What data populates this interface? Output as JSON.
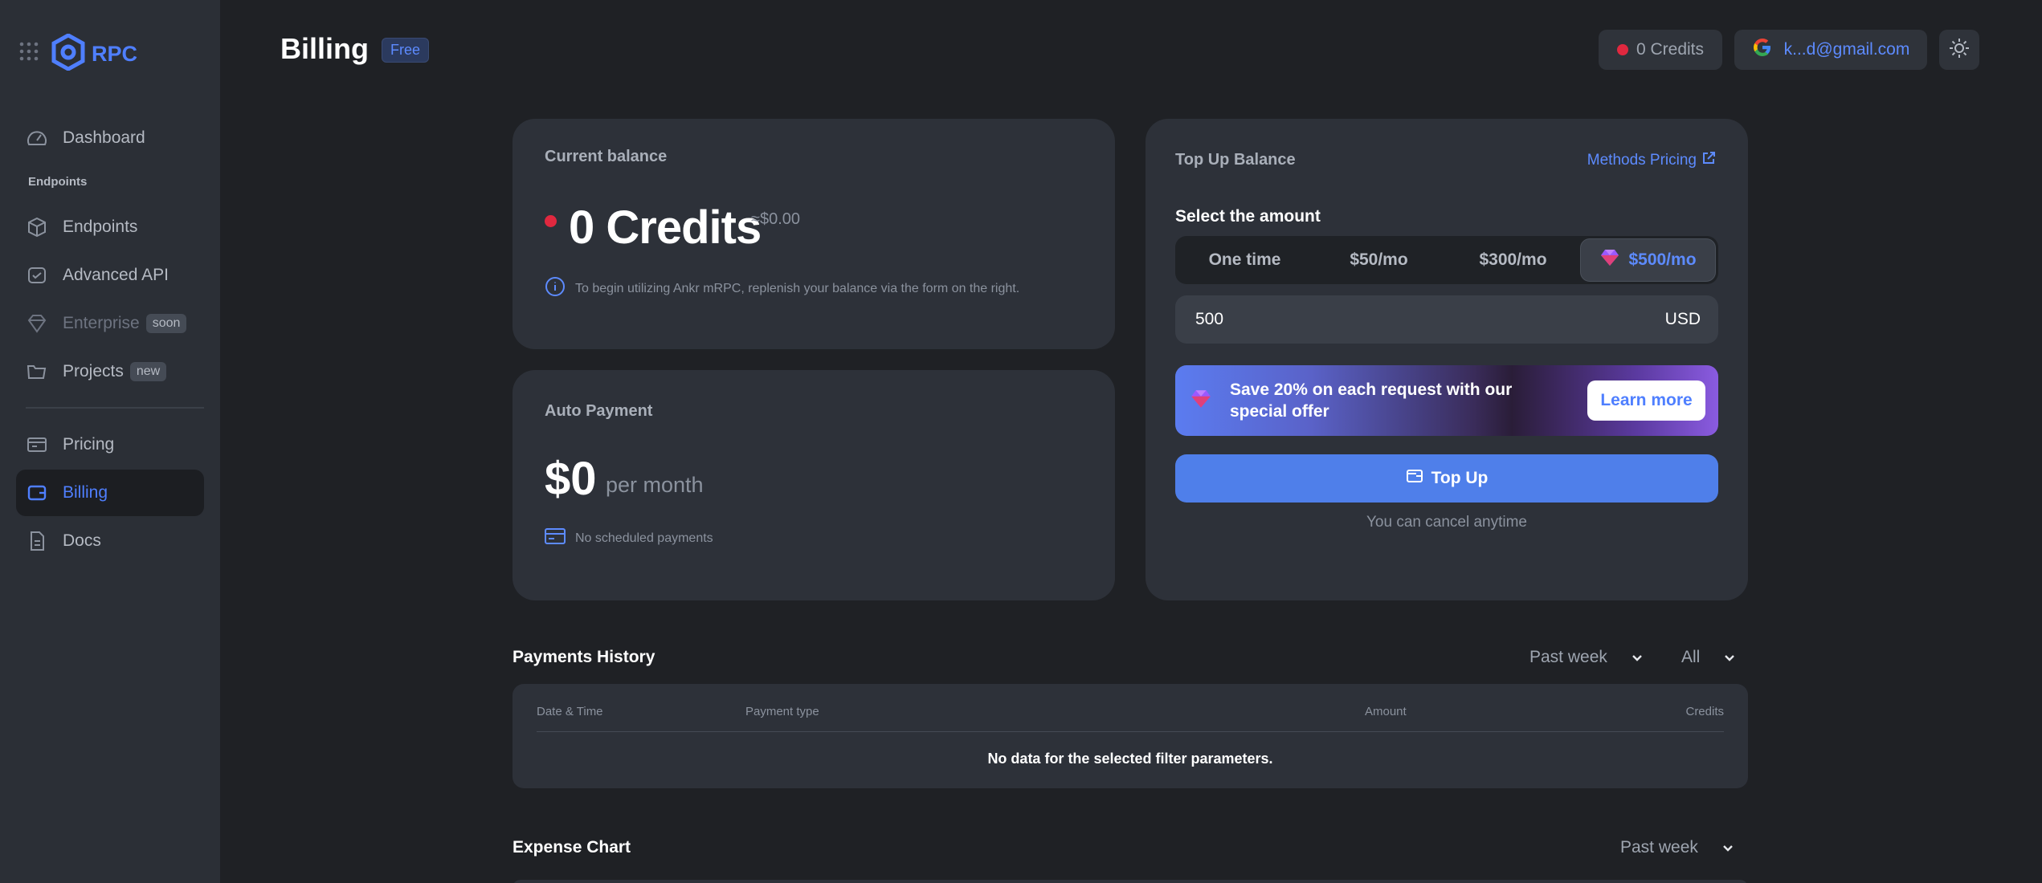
{
  "sidebar": {
    "logo_text": "RPC",
    "section_label": "Endpoints",
    "items": [
      {
        "label": "Dashboard",
        "icon": "gauge-icon"
      },
      {
        "label": "Endpoints",
        "icon": "cube-icon"
      },
      {
        "label": "Advanced API",
        "icon": "advanced-api-icon"
      },
      {
        "label": "Enterprise",
        "icon": "diamond-icon",
        "badge": "soon"
      },
      {
        "label": "Projects",
        "icon": "folder-icon",
        "badge": "new"
      },
      {
        "label": "Pricing",
        "icon": "pricing-icon"
      },
      {
        "label": "Billing",
        "icon": "wallet-icon"
      },
      {
        "label": "Docs",
        "icon": "document-icon"
      }
    ]
  },
  "header": {
    "title": "Billing",
    "plan_badge": "Free",
    "credits": "0 Credits",
    "user_email": "k...d@gmail.com"
  },
  "balance": {
    "title": "Current balance",
    "credits": "0 Credits",
    "usd_equiv": "≈$0.00",
    "info": "To begin utilizing Ankr mRPC, replenish your balance via the form on the right."
  },
  "auto_payment": {
    "title": "Auto Payment",
    "amount": "$0",
    "period": "per month",
    "schedule": "No scheduled payments"
  },
  "topup": {
    "title": "Top Up Balance",
    "methods_link": "Methods Pricing",
    "select_label": "Select the amount",
    "options": [
      "One time",
      "$50/mo",
      "$300/mo",
      "$500/mo"
    ],
    "selected_option": "$500/mo",
    "amount_value": "500",
    "currency": "USD",
    "promo_text": "Save 20% on each request with our special offer",
    "promo_button": "Learn more",
    "button": "Top Up",
    "cancel_note": "You can cancel anytime"
  },
  "payments_history": {
    "title": "Payments History",
    "period_filter": "Past week",
    "type_filter": "All",
    "columns": [
      "Date & Time",
      "Payment type",
      "Amount",
      "Credits"
    ],
    "empty_message": "No data for the selected filter parameters."
  },
  "expense_chart": {
    "title": "Expense Chart",
    "period_filter": "Past week"
  },
  "colors": {
    "accent": "#4f7fff",
    "status_red": "#e0283f",
    "background": "#1f2125",
    "sidebar": "#2b2f36",
    "card": "#2d3139"
  }
}
